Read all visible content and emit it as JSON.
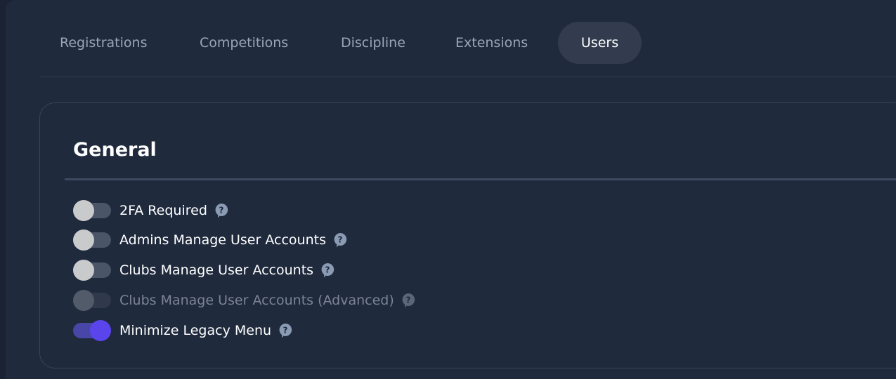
{
  "tabs": [
    {
      "label": "Registrations",
      "active": false
    },
    {
      "label": "Competitions",
      "active": false
    },
    {
      "label": "Discipline",
      "active": false
    },
    {
      "label": "Extensions",
      "active": false
    },
    {
      "label": "Users",
      "active": true
    }
  ],
  "card": {
    "title": "General",
    "settings": [
      {
        "label": "2FA Required",
        "enabled": false,
        "disabled": false,
        "help_icon": "question-bubble-icon"
      },
      {
        "label": "Admins Manage User Accounts",
        "enabled": false,
        "disabled": false,
        "help_icon": "question-bubble-icon"
      },
      {
        "label": "Clubs Manage User Accounts",
        "enabled": false,
        "disabled": false,
        "help_icon": "question-bubble-icon"
      },
      {
        "label": "Clubs Manage User Accounts (Advanced)",
        "enabled": false,
        "disabled": true,
        "help_icon": "question-bubble-icon"
      },
      {
        "label": "Minimize Legacy Menu",
        "enabled": true,
        "disabled": false,
        "help_icon": "question-bubble-icon"
      }
    ]
  },
  "colors": {
    "background": "#1f2a3d",
    "accent": "#5a45ec",
    "tab_active_bg": "#323c4e",
    "help_icon": "#8a9bb3"
  }
}
